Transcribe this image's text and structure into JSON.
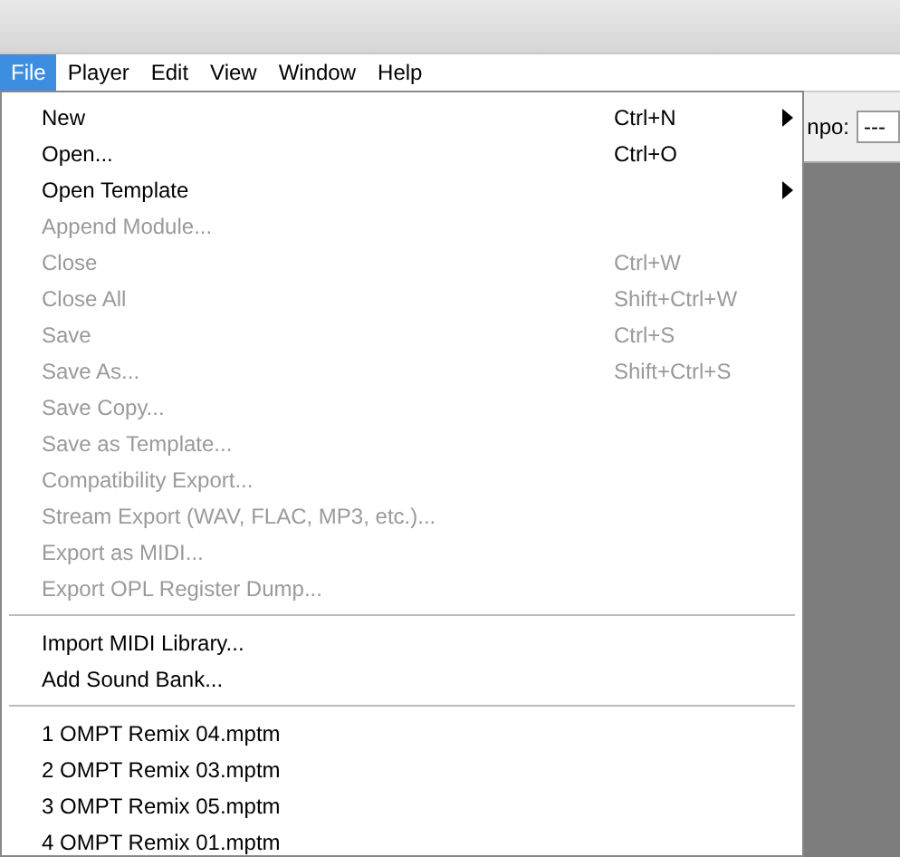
{
  "menubar": [
    {
      "label": "File",
      "selected": true
    },
    {
      "label": "Player",
      "selected": false
    },
    {
      "label": "Edit",
      "selected": false
    },
    {
      "label": "View",
      "selected": false
    },
    {
      "label": "Window",
      "selected": false
    },
    {
      "label": "Help",
      "selected": false
    }
  ],
  "toolbar": {
    "label": "npo:",
    "field_value": "---"
  },
  "file_menu": [
    {
      "kind": "item",
      "label": "New",
      "shortcut": "Ctrl+N",
      "disabled": false,
      "submenu": true
    },
    {
      "kind": "item",
      "label": "Open...",
      "shortcut": "Ctrl+O",
      "disabled": false,
      "submenu": false
    },
    {
      "kind": "item",
      "label": "Open Template",
      "disabled": false,
      "submenu": true
    },
    {
      "kind": "item",
      "label": "Append Module...",
      "disabled": true,
      "submenu": false
    },
    {
      "kind": "item",
      "label": "Close",
      "shortcut": "Ctrl+W",
      "disabled": true,
      "submenu": false
    },
    {
      "kind": "item",
      "label": "Close All",
      "shortcut": "Shift+Ctrl+W",
      "disabled": true,
      "submenu": false
    },
    {
      "kind": "item",
      "label": "Save",
      "shortcut": "Ctrl+S",
      "disabled": true,
      "submenu": false
    },
    {
      "kind": "item",
      "label": "Save As...",
      "shortcut": "Shift+Ctrl+S",
      "disabled": true,
      "submenu": false
    },
    {
      "kind": "item",
      "label": "Save Copy...",
      "disabled": true,
      "submenu": false
    },
    {
      "kind": "item",
      "label": "Save as Template...",
      "disabled": true,
      "submenu": false
    },
    {
      "kind": "item",
      "label": "Compatibility Export...",
      "disabled": true,
      "submenu": false
    },
    {
      "kind": "item",
      "label": "Stream Export (WAV, FLAC, MP3, etc.)...",
      "disabled": true,
      "submenu": false
    },
    {
      "kind": "item",
      "label": "Export as MIDI...",
      "disabled": true,
      "submenu": false
    },
    {
      "kind": "item",
      "label": "Export OPL Register Dump...",
      "disabled": true,
      "submenu": false
    },
    {
      "kind": "separator"
    },
    {
      "kind": "item",
      "label": "Import MIDI Library...",
      "disabled": false,
      "submenu": false
    },
    {
      "kind": "item",
      "label": "Add Sound Bank...",
      "disabled": false,
      "submenu": false
    },
    {
      "kind": "separator"
    },
    {
      "kind": "item",
      "label": "1 OMPT Remix 04.mptm",
      "disabled": false,
      "submenu": false
    },
    {
      "kind": "item",
      "label": "2 OMPT Remix 03.mptm",
      "disabled": false,
      "submenu": false
    },
    {
      "kind": "item",
      "label": "3 OMPT Remix 05.mptm",
      "disabled": false,
      "submenu": false
    },
    {
      "kind": "item",
      "label": "4 OMPT Remix 01.mptm",
      "disabled": false,
      "submenu": false
    }
  ]
}
